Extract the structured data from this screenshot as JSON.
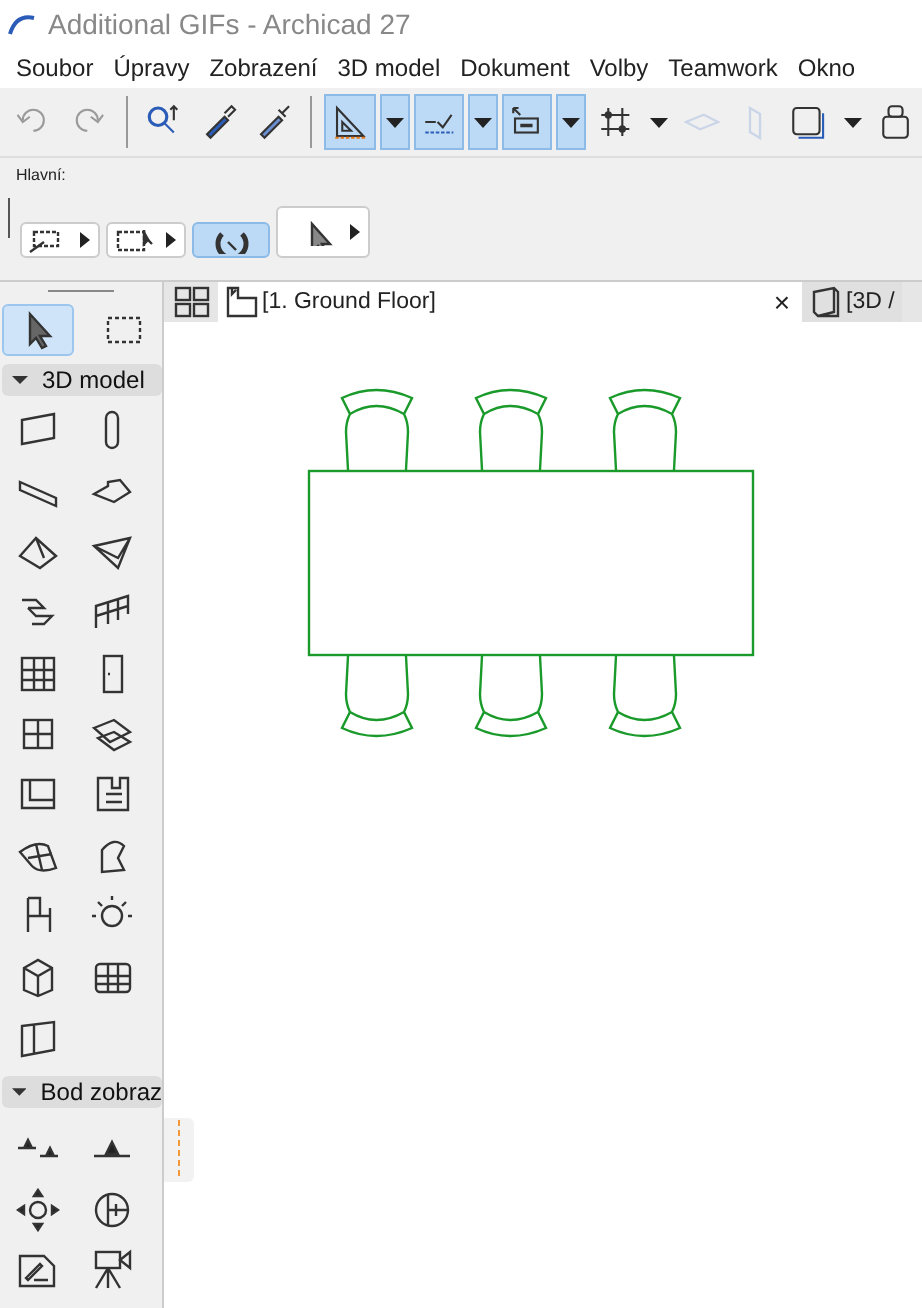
{
  "window": {
    "title": "Additional GIFs - Archicad 27"
  },
  "menu": [
    "Soubor",
    "Úpravy",
    "Zobrazení",
    "3D model",
    "Dokument",
    "Volby",
    "Teamwork",
    "Okno"
  ],
  "toolbar": [
    {
      "kind": "button",
      "selected": false,
      "disabled": true
    },
    {
      "kind": "button",
      "selected": false,
      "disabled": true
    },
    {
      "kind": "separator"
    },
    {
      "kind": "button",
      "selected": false,
      "disabled": false
    },
    {
      "kind": "button",
      "selected": false,
      "disabled": false
    },
    {
      "kind": "button",
      "selected": false,
      "disabled": false
    },
    {
      "kind": "separator"
    },
    {
      "kind": "split",
      "selected": true,
      "disabled": false
    },
    {
      "kind": "split",
      "selected": true,
      "disabled": false
    },
    {
      "kind": "split",
      "selected": true,
      "disabled": false
    },
    {
      "kind": "split",
      "selected": false,
      "disabled": false
    },
    {
      "kind": "button",
      "selected": false,
      "disabled": true
    },
    {
      "kind": "button",
      "selected": false,
      "disabled": true
    },
    {
      "kind": "split",
      "selected": false,
      "disabled": false
    },
    {
      "kind": "button",
      "selected": false,
      "disabled": false
    }
  ],
  "info_box": {
    "label": "Hlavní:",
    "buttons": [
      {
        "selected": false
      },
      {
        "selected": false
      },
      {
        "selected": true
      },
      {
        "selected": false
      }
    ]
  },
  "palette": {
    "selection_tools": [
      {
        "selected": true
      },
      {
        "selected": false
      }
    ],
    "sections": [
      {
        "title": "3D model",
        "expanded": true
      },
      {
        "title": "Bod zobraz",
        "expanded": true
      }
    ]
  },
  "tabs": [
    {
      "label": "[1. Ground Floor]",
      "selected": true,
      "close": "×"
    },
    {
      "label": "[3D /",
      "selected": false
    }
  ]
}
